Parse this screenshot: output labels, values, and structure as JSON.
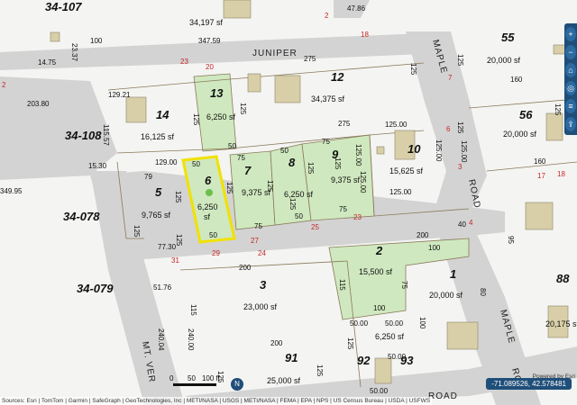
{
  "roads": {
    "juniper": "JUNIPER",
    "maple_top": "MAPLE",
    "road_right": "ROAD",
    "maple_bottom": "MAPLE",
    "ro": "RO",
    "mt_vernon": "MT. VER",
    "road_bottom": "ROAD"
  },
  "parcels": {
    "p107": "34-107",
    "p108": "34-108",
    "p078": "34-078",
    "p079": "34-079",
    "n13": "13",
    "sf13": "6,250 sf",
    "n12": "12",
    "sf12": "34,375 sf",
    "n14": "14",
    "sf14": "16,125 sf",
    "n55": "55",
    "sf55": "20,000 sf",
    "n56": "56",
    "sf56": "20,000 sf",
    "n10": "10",
    "sf10": "15,625 sf",
    "n6": "6",
    "sf6a": "6,250",
    "sf6b": "sf",
    "n5": "5",
    "sf5": "9,765 sf",
    "n7": "7",
    "sf7": "9,375 sf",
    "n8": "8",
    "sf8": "6,250 sf",
    "n9": "9",
    "sf9": "9,375 sf",
    "n2": "2",
    "sf2": "15,500 sf",
    "n1": "1",
    "sf1": "20,000 sf",
    "n3": "3",
    "sf3": "23,000 sf",
    "n88": "88",
    "sf88": "20,175 sf",
    "n91": "91",
    "sf91": "25,000 sf",
    "n92": "92",
    "n93": "93",
    "sf9293": "6,250 sf",
    "sf34197": "34,197 sf"
  },
  "dims": {
    "d4786": "47.86",
    "d2337": "23.37",
    "d100a": "100",
    "d34759": "347.59",
    "d1475": "14.75",
    "d275a": "275",
    "d125a": "125",
    "d125b": "125",
    "d12921": "129.21",
    "d20380": "203.80",
    "d11557": "115.57",
    "d125c": "125",
    "d125d": "125",
    "d50a": "50",
    "d275b": "275",
    "d12500a": "125.00",
    "d12500b": "125.00",
    "d12500c": "125.00",
    "d160a": "160",
    "d125e": "125",
    "d12500d": "125.00",
    "d160b": "160",
    "d125f": "125",
    "d12900": "129.00",
    "d1530": "15.30",
    "d34995": "349.95",
    "d79": "79",
    "d50b": "50",
    "d75a": "75",
    "d50c": "50",
    "d75b": "75",
    "d125g": "125",
    "d125h": "125",
    "d125i": "125",
    "d125j": "125",
    "d125k": "125",
    "d125l": "125",
    "d12500e": "125.00",
    "d125m": "125",
    "d50d": "50",
    "d75c": "75",
    "d50e": "50",
    "d75d": "75",
    "d12500f": "125.00",
    "d125n": "125",
    "d7730": "77.30",
    "d200a": "200",
    "d100b": "100",
    "d40": "40",
    "d95": "95",
    "d200b": "200",
    "d5176": "51.76",
    "d115a": "115",
    "d75e": "75",
    "d80": "80",
    "d115b": "115",
    "d24000": "240.00",
    "d24004": "240.04",
    "d100c": "100",
    "d200c": "200",
    "d5000a": "50.00",
    "d5000b": "50.00",
    "d100d": "100",
    "d125o": "125",
    "d5000c": "50.00",
    "d5000d": "50.00",
    "d125p": "125",
    "d125q": "125"
  },
  "red_labels": {
    "r2a": "2",
    "r2b": "2",
    "r23a": "23",
    "r20": "20",
    "r18": "18",
    "r7": "7",
    "r6": "6",
    "r3": "3",
    "r31": "31",
    "r29": "29",
    "r27": "27",
    "r24": "24",
    "r25": "25",
    "r23b": "23",
    "r4": "4",
    "r17": "17",
    "r18b": "18"
  },
  "ui": {
    "attribution": "Sources: Esri | TomTom | Garmin | SafeGraph | GeoTechnologies, Inc | METI/NASA | USGS | METI/NASA | FEMA | EPA | NPS | US Census Bureau | USDA | USFWS",
    "powered_by": "Powered by Esri",
    "coords": "-71.089526, 42.578481",
    "scale_left": "0",
    "scale_mid": "50",
    "scale_right": "100 ft",
    "north": "N"
  },
  "colors": {
    "road": "#d3d3d3",
    "parcel_highlight": "#cfe8bf",
    "selection": "#f1e100",
    "red_label": "#c62828",
    "control": "#1f4e79"
  }
}
